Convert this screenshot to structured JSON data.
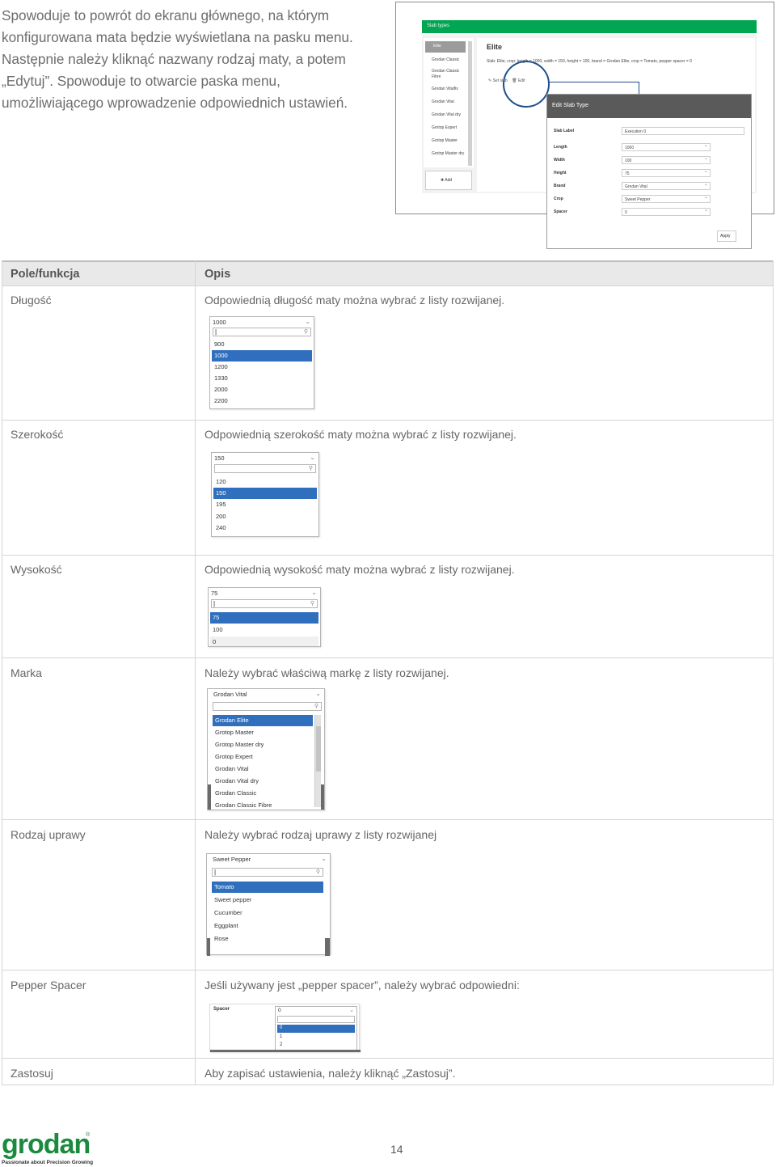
{
  "intro": {
    "text": "Spowoduje to powrót do ekranu głównego, na którym konfigurowana mata będzie wyświetlana na pasku menu. Następnie należy kliknąć nazwany rodzaj maty, a potem „Edytuj”. Spowoduje to otwarcie paska menu, umożliwiającego wprowadzenie odpowiednich ustawień."
  },
  "screenshot": {
    "topbar": "Slab types",
    "sidebar_selected": "Elite",
    "sidebar_items": [
      "Grodan Classic",
      "Grodan Classic Fibre",
      "Grodan Vitalfix",
      "Grodan Vital",
      "Grodan Vital dry",
      "Grotop Expert",
      "Grotop Master",
      "Grotop Master dry"
    ],
    "add_label": "✚ Add",
    "main_title": "Elite",
    "main_line": "Slab: Elite, crop: length = 1000, width = 150, height = 100, brand = Grodan Elite, crop = Tomato, pepper spacer = 0",
    "actions": [
      "✎ Set slab",
      "🗑 Edit"
    ],
    "dialog": {
      "title": "Edit Slab Type",
      "rows": [
        {
          "label": "Slab Label",
          "value": "Execution 0"
        },
        {
          "label": "Length",
          "value": "1000"
        },
        {
          "label": "Width",
          "value": "100"
        },
        {
          "label": "Height",
          "value": "75"
        },
        {
          "label": "Brand",
          "value": "Grodan Vital"
        },
        {
          "label": "Crop",
          "value": "Sweet Pepper"
        },
        {
          "label": "Spacer",
          "value": "0"
        }
      ],
      "apply": "Apply"
    }
  },
  "table": {
    "headers": {
      "field": "Pole/funkcja",
      "desc": "Opis"
    },
    "rows": [
      {
        "field": "Długość",
        "desc": "Odpowiednią długość maty można wybrać z listy rozwijanej.",
        "dropdown": {
          "current": "1000",
          "options": [
            "900",
            "1000",
            "1200",
            "1330",
            "2000",
            "2200"
          ],
          "selected": 1
        }
      },
      {
        "field": "Szerokość",
        "desc": "Odpowiednią szerokość maty można wybrać z listy rozwijanej.",
        "dropdown": {
          "current": "150",
          "options": [
            "120",
            "150",
            "195",
            "200",
            "240"
          ],
          "selected": 1
        }
      },
      {
        "field": "Wysokość",
        "desc": "Odpowiednią wysokość maty można wybrać z listy rozwijanej.",
        "dropdown": {
          "current": "75",
          "options": [
            "75",
            "100",
            "0"
          ],
          "selected": 0
        }
      },
      {
        "field": "Marka",
        "desc": "Należy wybrać właściwą markę z listy rozwijanej.",
        "dropdown": {
          "current": "Grodan Vital",
          "options": [
            "Grodan Elite",
            "Grotop Master",
            "Grotop Master dry",
            "Grotop Expert",
            "Grodan Vital",
            "Grodan Vital dry",
            "Grodan Classic",
            "Grodan Classic Fibre"
          ],
          "selected": 0
        }
      },
      {
        "field": "Rodzaj uprawy",
        "desc": "Należy wybrać rodzaj uprawy z listy rozwijanej",
        "dropdown": {
          "current": "Sweet Pepper",
          "options": [
            "Tomato",
            "Sweet pepper",
            "Cucumber",
            "Eggplant",
            "Rose"
          ],
          "selected": 0
        }
      },
      {
        "field": "Pepper Spacer",
        "desc": "Jeśli używany jest „pepper spacer”, należy wybrać odpowiedni:",
        "dropdown": {
          "label": "Spacer",
          "current": "0",
          "options": [
            "0",
            "1",
            "2"
          ],
          "selected": 0
        }
      },
      {
        "field": "Zastosuj",
        "desc": "Aby zapisać ustawienia, należy kliknąć „Zastosuj”."
      }
    ]
  },
  "footer": {
    "logo_word": "grodan",
    "logo_reg": "®",
    "logo_tagline": "Passionate about Precision Growing",
    "page_number": "14"
  },
  "colors": {
    "brand_green": "#1b8a3f",
    "select_blue": "#2f6fbd",
    "app_green": "#00a651"
  }
}
